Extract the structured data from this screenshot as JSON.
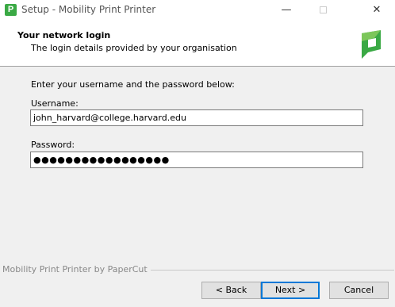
{
  "window": {
    "app_icon_letter": "P",
    "title": "Setup - Mobility Print Printer",
    "minimize_glyph": "—",
    "close_glyph": "✕"
  },
  "header": {
    "title": "Your network login",
    "subtitle": "The login details provided by your organisation",
    "logo_icon": "papercut-logo-icon",
    "logo_color": "#3aa944"
  },
  "form": {
    "instruction": "Enter your username and the password below:",
    "username_label": "Username:",
    "username_value": "john_harvard@college.harvard.edu",
    "password_label": "Password:",
    "password_value": "●●●●●●●●●●●●●●●●●"
  },
  "footer": {
    "brand": "Mobility Print Printer by PaperCut"
  },
  "buttons": {
    "back": "< Back",
    "next": "Next >",
    "cancel": "Cancel"
  },
  "colors": {
    "accent": "#0078d7",
    "brand_green": "#3aa944"
  }
}
